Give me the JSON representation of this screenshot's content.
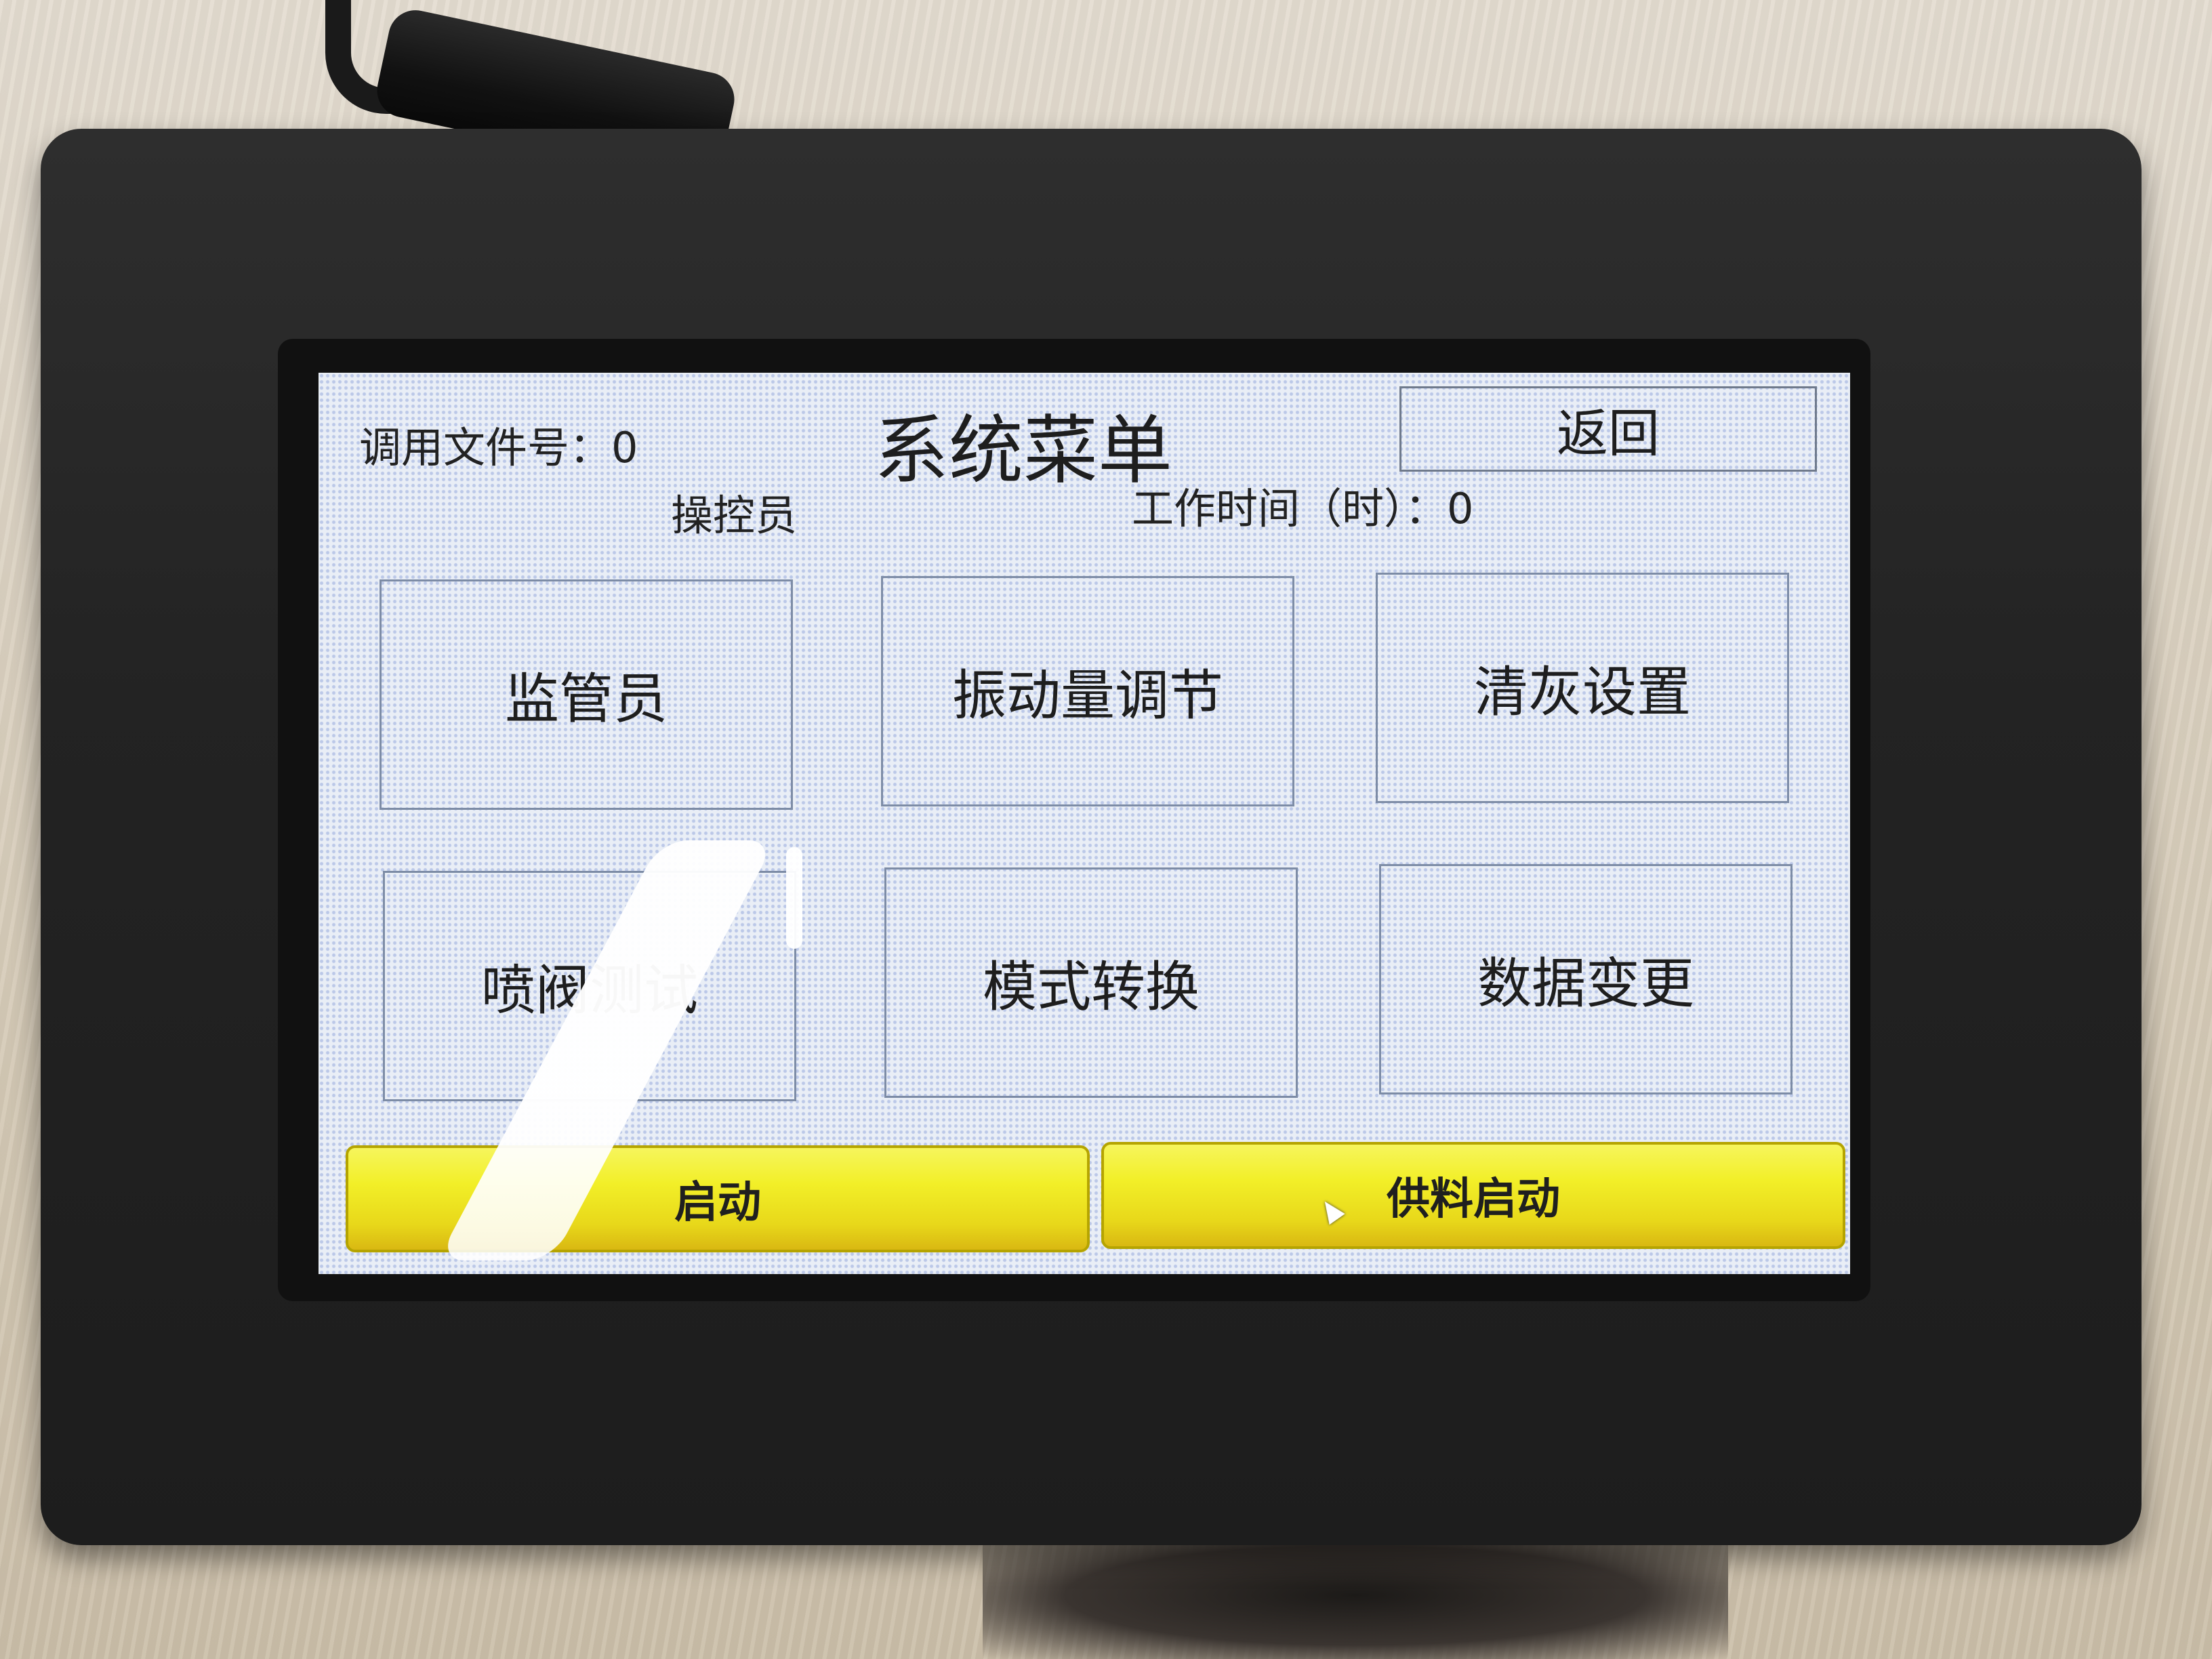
{
  "screen": {
    "file_label": "调用文件号：0",
    "title": "系统菜单",
    "back_label": "返回",
    "operator_label": "操控员",
    "work_time_label": "工作时间（时）：0"
  },
  "menu_buttons": [
    {
      "label": "监管员"
    },
    {
      "label": "振动量调节"
    },
    {
      "label": "清灰设置"
    },
    {
      "label": "喷阀测试"
    },
    {
      "label": "模式转换"
    },
    {
      "label": "数据变更"
    }
  ],
  "action_buttons": [
    {
      "label": "启动"
    },
    {
      "label": "供料启动"
    }
  ],
  "colors": {
    "screen_background": "#e9eef6",
    "action_button": "#f2ef28",
    "housing": "#232323"
  },
  "icons": {
    "cursor": "pointer-cursor-icon"
  }
}
